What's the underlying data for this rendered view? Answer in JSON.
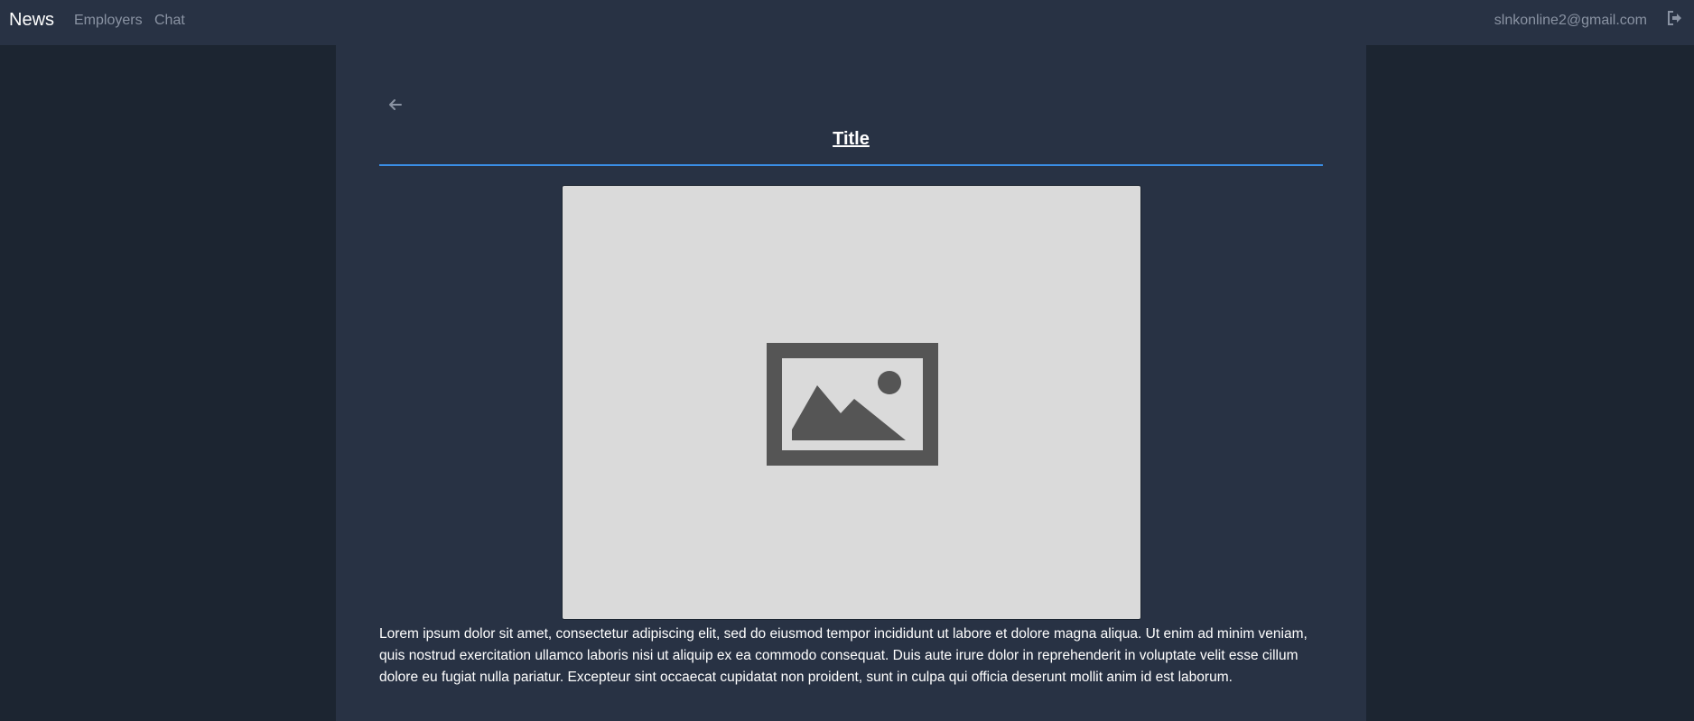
{
  "navbar": {
    "brand": "News",
    "links": [
      "Employers",
      "Chat"
    ],
    "user_email": "slnkonline2@gmail.com"
  },
  "article": {
    "title": "Title",
    "body": "Lorem ipsum dolor sit amet, consectetur adipiscing elit, sed do eiusmod tempor incididunt ut labore et dolore magna aliqua. Ut enim ad minim veniam, quis nostrud exercitation ullamco laboris nisi ut aliquip ex ea commodo consequat. Duis aute irure dolor in reprehenderit in voluptate velit esse cillum dolore eu fugiat nulla pariatur. Excepteur sint occaecat cupidatat non proident, sunt in culpa qui officia deserunt mollit anim id est laborum."
  },
  "icons": {
    "back": "arrow-left-icon",
    "logout": "sign-out-icon",
    "image": "image-placeholder-icon"
  },
  "colors": {
    "accent": "#3a8ee6",
    "navbar_bg": "#283244",
    "page_bg": "#1c2531",
    "placeholder_bg": "#dadada",
    "placeholder_icon": "#555555"
  }
}
